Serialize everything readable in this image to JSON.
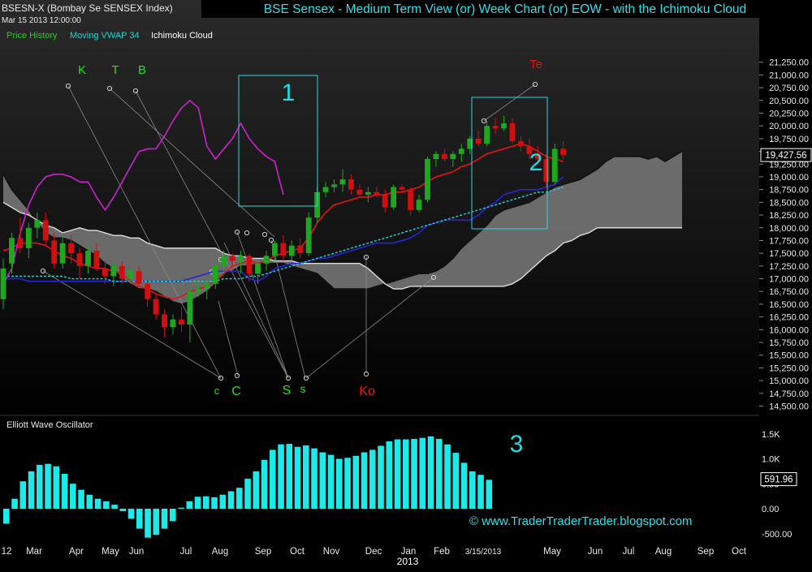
{
  "header": {
    "symbol": "BSESN-X (Bombay Se SENSEX Index)",
    "datetime": "Mar 15 2013 12:00:00",
    "title": "BSE Sensex - Medium Term View (or) Week Chart (or) EOW - with the Ichimoku Cloud"
  },
  "legend": {
    "items": [
      {
        "label": "Price History",
        "color": "#22cc22"
      },
      {
        "label": "Moving VWAP 34",
        "color": "#22d3d3"
      },
      {
        "label": "Ichimoku Cloud",
        "color": "#ffffff"
      }
    ]
  },
  "colors": {
    "background": "#000000",
    "up_candle": "#1fa81f",
    "down_candle": "#d01010",
    "tenkan": "#e01515",
    "kijun": "#2626d8",
    "vwap": "#22d3d3",
    "chikou": "#cc22cc",
    "cloud_fill": "#7a7a7a",
    "span_a": "#111111",
    "span_b": "#dddddd",
    "oscillator": "#1ee8e8",
    "annotation_box": "#2ad8e0",
    "accent_red": "#e01515"
  },
  "price_panel": {
    "ylim": [
      14500,
      21500
    ],
    "y_ticks": [
      "21,250.00",
      "21,000.00",
      "20,750.00",
      "20,500.00",
      "20,250.00",
      "20,000.00",
      "19,750.00",
      "19,500.00",
      "19,250.00",
      "19,000.00",
      "18,750.00",
      "18,500.00",
      "18,250.00",
      "18,000.00",
      "17,750.00",
      "17,500.00",
      "17,250.00",
      "17,000.00",
      "16,750.00",
      "16,500.00",
      "16,250.00",
      "16,000.00",
      "15,750.00",
      "15,500.00",
      "15,250.00",
      "15,000.00",
      "14,750.00",
      "14,500.00"
    ],
    "last_value": "19,427.56",
    "box_labels": [
      "1",
      "2"
    ]
  },
  "oscillator_panel": {
    "title": "Elliott Wave Oscillator",
    "ylim": [
      -600,
      1600
    ],
    "y_ticks": [
      "1.5K",
      "1.0K",
      "0.50",
      "0.00",
      "-500.00"
    ],
    "last_value": "591.96",
    "box_label": "3"
  },
  "x_axis": {
    "labels": [
      "12",
      "Mar",
      "Apr",
      "May",
      "Jun",
      "Jul",
      "Aug",
      "Sep",
      "Oct",
      "Nov",
      "Dec",
      "Jan",
      "Feb",
      "3/15/2013",
      "May",
      "Jun",
      "Jul",
      "Aug",
      "Sep",
      "Oct"
    ],
    "year_label": "2013"
  },
  "annotations": {
    "top_green": [
      "K",
      "T",
      "B"
    ],
    "top_red": "Te",
    "bottom_green": [
      "c",
      "C",
      "S",
      "s"
    ],
    "bottom_red": "Ko"
  },
  "watermark": "© www.TraderTraderTrader.blogspot.com",
  "chart_data": {
    "type": "candlestick",
    "title": "BSE Sensex - Medium Term View (or) Week Chart (or) EOW - with the Ichimoku Cloud",
    "candles": [
      {
        "o": 16600,
        "h": 17400,
        "l": 16400,
        "c": 17200
      },
      {
        "o": 17300,
        "h": 17900,
        "l": 17100,
        "c": 17800
      },
      {
        "o": 17800,
        "h": 18200,
        "l": 17500,
        "c": 17600
      },
      {
        "o": 17600,
        "h": 18100,
        "l": 17400,
        "c": 18000
      },
      {
        "o": 18000,
        "h": 18300,
        "l": 17800,
        "c": 18150
      },
      {
        "o": 18150,
        "h": 18300,
        "l": 17650,
        "c": 17750
      },
      {
        "o": 17750,
        "h": 17900,
        "l": 17200,
        "c": 17300
      },
      {
        "o": 17300,
        "h": 17900,
        "l": 17200,
        "c": 17700
      },
      {
        "o": 17700,
        "h": 17850,
        "l": 17300,
        "c": 17500
      },
      {
        "o": 17500,
        "h": 17600,
        "l": 17000,
        "c": 17250
      },
      {
        "o": 17250,
        "h": 17650,
        "l": 17100,
        "c": 17550
      },
      {
        "o": 17550,
        "h": 17700,
        "l": 17150,
        "c": 17200
      },
      {
        "o": 17200,
        "h": 17350,
        "l": 16900,
        "c": 17050
      },
      {
        "o": 17050,
        "h": 17350,
        "l": 16850,
        "c": 17250
      },
      {
        "o": 17250,
        "h": 17350,
        "l": 16900,
        "c": 17000
      },
      {
        "o": 17000,
        "h": 17200,
        "l": 16900,
        "c": 17150
      },
      {
        "o": 17150,
        "h": 17250,
        "l": 16850,
        "c": 16900
      },
      {
        "o": 16900,
        "h": 16950,
        "l": 16450,
        "c": 16600
      },
      {
        "o": 16600,
        "h": 16700,
        "l": 16200,
        "c": 16300
      },
      {
        "o": 16300,
        "h": 16400,
        "l": 15850,
        "c": 16050
      },
      {
        "o": 16050,
        "h": 16300,
        "l": 15900,
        "c": 16200
      },
      {
        "o": 16200,
        "h": 16450,
        "l": 15950,
        "c": 16100
      },
      {
        "o": 16100,
        "h": 16850,
        "l": 15750,
        "c": 16750
      },
      {
        "o": 16750,
        "h": 16950,
        "l": 16650,
        "c": 16800
      },
      {
        "o": 16800,
        "h": 17000,
        "l": 16600,
        "c": 16900
      },
      {
        "o": 16900,
        "h": 17300,
        "l": 16800,
        "c": 17250
      },
      {
        "o": 17250,
        "h": 17550,
        "l": 17100,
        "c": 17450
      },
      {
        "o": 17450,
        "h": 17500,
        "l": 17250,
        "c": 17350
      },
      {
        "o": 17350,
        "h": 17550,
        "l": 17100,
        "c": 17450
      },
      {
        "o": 17450,
        "h": 17500,
        "l": 16950,
        "c": 17100
      },
      {
        "o": 17100,
        "h": 17350,
        "l": 16900,
        "c": 17300
      },
      {
        "o": 17300,
        "h": 17550,
        "l": 17150,
        "c": 17450
      },
      {
        "o": 17450,
        "h": 17750,
        "l": 17350,
        "c": 17700
      },
      {
        "o": 17700,
        "h": 17850,
        "l": 17350,
        "c": 17450
      },
      {
        "o": 17450,
        "h": 17750,
        "l": 17350,
        "c": 17650
      },
      {
        "o": 17650,
        "h": 17800,
        "l": 17400,
        "c": 17500
      },
      {
        "o": 17500,
        "h": 18300,
        "l": 17450,
        "c": 18200
      },
      {
        "o": 18200,
        "h": 18800,
        "l": 18100,
        "c": 18700
      },
      {
        "o": 18700,
        "h": 18900,
        "l": 18600,
        "c": 18800
      },
      {
        "o": 18800,
        "h": 18950,
        "l": 18700,
        "c": 18850
      },
      {
        "o": 18850,
        "h": 19150,
        "l": 18700,
        "c": 18950
      },
      {
        "o": 18950,
        "h": 19050,
        "l": 18650,
        "c": 18750
      },
      {
        "o": 18750,
        "h": 18850,
        "l": 18600,
        "c": 18650
      },
      {
        "o": 18650,
        "h": 18800,
        "l": 18500,
        "c": 18700
      },
      {
        "o": 18700,
        "h": 18800,
        "l": 18600,
        "c": 18650
      },
      {
        "o": 18650,
        "h": 18750,
        "l": 18300,
        "c": 18400
      },
      {
        "o": 18400,
        "h": 18850,
        "l": 18350,
        "c": 18800
      },
      {
        "o": 18800,
        "h": 18850,
        "l": 18700,
        "c": 18750
      },
      {
        "o": 18750,
        "h": 18800,
        "l": 18250,
        "c": 18350
      },
      {
        "o": 18350,
        "h": 18650,
        "l": 18300,
        "c": 18550
      },
      {
        "o": 18550,
        "h": 19400,
        "l": 18500,
        "c": 19350
      },
      {
        "o": 19350,
        "h": 19500,
        "l": 19200,
        "c": 19450
      },
      {
        "o": 19450,
        "h": 19550,
        "l": 19300,
        "c": 19350
      },
      {
        "o": 19350,
        "h": 19500,
        "l": 19200,
        "c": 19450
      },
      {
        "o": 19450,
        "h": 19650,
        "l": 19300,
        "c": 19550
      },
      {
        "o": 19550,
        "h": 19800,
        "l": 19450,
        "c": 19750
      },
      {
        "o": 19750,
        "h": 19900,
        "l": 19600,
        "c": 19650
      },
      {
        "o": 19650,
        "h": 20100,
        "l": 19600,
        "c": 20000
      },
      {
        "o": 20000,
        "h": 20150,
        "l": 19850,
        "c": 19950
      },
      {
        "o": 19950,
        "h": 20200,
        "l": 19900,
        "c": 20050
      },
      {
        "o": 20050,
        "h": 20150,
        "l": 19650,
        "c": 19700
      },
      {
        "o": 19700,
        "h": 19800,
        "l": 19500,
        "c": 19600
      },
      {
        "o": 19600,
        "h": 19750,
        "l": 19350,
        "c": 19450
      },
      {
        "o": 19450,
        "h": 19600,
        "l": 19250,
        "c": 19350
      },
      {
        "o": 19350,
        "h": 19450,
        "l": 18800,
        "c": 18900
      },
      {
        "o": 18900,
        "h": 19650,
        "l": 18850,
        "c": 19550
      },
      {
        "o": 19550,
        "h": 19700,
        "l": 19350,
        "c": 19427.56
      }
    ],
    "tenkan": [
      17550,
      17600,
      17700,
      17700,
      17700,
      17650,
      17550,
      17450,
      17400,
      17300,
      17250,
      17200,
      17200,
      17150,
      17100,
      16950,
      16850,
      16800,
      16700,
      16650,
      16600,
      16650,
      16750,
      16800,
      16850,
      16950,
      17100,
      17250,
      17300,
      17350,
      17300,
      17350,
      17450,
      17500,
      17550,
      17600,
      17800,
      18100,
      18300,
      18450,
      18500,
      18550,
      18600,
      18600,
      18650,
      18650,
      18700,
      18700,
      18750,
      18800,
      18900,
      19000,
      19050,
      19100,
      19200,
      19250,
      19350,
      19450,
      19500,
      19550,
      19600,
      19650,
      19600,
      19500,
      19400,
      19350,
      19300
    ],
    "kijun": [
      17000,
      17000,
      17000,
      16950,
      16950,
      16950,
      16950,
      16950,
      16950,
      16950,
      16950,
      16950,
      16950,
      16950,
      16950,
      16950,
      16950,
      16950,
      16950,
      16950,
      16950,
      16950,
      17000,
      17050,
      17100,
      17150,
      17150,
      17150,
      17150,
      17000,
      16950,
      17050,
      17200,
      17250,
      17300,
      17300,
      17350,
      17400,
      17400,
      17450,
      17500,
      17550,
      17600,
      17650,
      17700,
      17700,
      17700,
      17750,
      17800,
      17900,
      18050,
      18100,
      18150,
      18150,
      18150,
      18150,
      18250,
      18400,
      18500,
      18650,
      18700,
      18750,
      18750,
      18750,
      18800,
      18850,
      19000
    ],
    "vwap": [
      17050,
      17050,
      17050,
      17050,
      17050,
      17050,
      17050,
      17050,
      17000,
      17000,
      17000,
      17000,
      17000,
      16950,
      16950,
      16950,
      16950,
      16950,
      16950,
      16950,
      16950,
      16950,
      16950,
      16950,
      16950,
      16950,
      17000,
      17000,
      17000,
      17050,
      17050,
      17100,
      17150,
      17200,
      17250,
      17300,
      17350,
      17400,
      17450,
      17500,
      17550,
      17600,
      17650,
      17700,
      17750,
      17800,
      17850,
      17900,
      17950,
      18000,
      18050,
      18100,
      18150,
      18200,
      18250,
      18300,
      18350,
      18400,
      18450,
      18500,
      18550,
      18600,
      18650,
      18700,
      18700,
      18750,
      18800
    ],
    "chikou": [
      16900,
      17200,
      17900,
      18450,
      18800,
      19000,
      19050,
      19050,
      19000,
      18900,
      18900,
      18600,
      18350,
      18600,
      18900,
      19200,
      19500,
      19550,
      19550,
      19800,
      20100,
      20350,
      20500,
      20350,
      19600,
      19350,
      19550,
      19750,
      20050,
      19750,
      19550,
      19400,
      19300,
      18650
    ],
    "span_a": [
      19050,
      18750,
      18550,
      18350,
      18100,
      17900,
      17800,
      17800,
      17750,
      17650,
      17550,
      17450,
      17300,
      17200,
      17000,
      16900,
      16800,
      16800,
      16750,
      16650,
      16550,
      16500,
      16550,
      16650,
      16750,
      16900,
      17100,
      17150,
      17250,
      17250,
      17300,
      17300,
      17300,
      17300,
      17250,
      17200,
      17150,
      17100,
      16950,
      16800,
      16800,
      16800,
      16800,
      16800,
      16850,
      16900,
      16950,
      17000,
      17050,
      17100,
      17100,
      17150,
      17250,
      17400,
      17600,
      17750,
      17900,
      18050,
      18250,
      18350,
      18400,
      18450,
      18500,
      18600,
      18700,
      18800,
      18850,
      18900,
      18950,
      19050,
      19150,
      19300,
      19400,
      19400,
      19400,
      19400,
      19350,
      19400,
      19300,
      19400,
      19500
    ],
    "span_b": [
      18500,
      18400,
      18300,
      18250,
      18150,
      18050,
      18000,
      17900,
      17950,
      18000,
      17950,
      17950,
      17900,
      17850,
      17850,
      17800,
      17800,
      17700,
      17650,
      17600,
      17600,
      17600,
      17600,
      17600,
      17600,
      17600,
      17500,
      17450,
      17450,
      17400,
      17400,
      17400,
      17350,
      17350,
      17350,
      17300,
      17300,
      17300,
      17300,
      17300,
      17300,
      17300,
      17300,
      17200,
      17050,
      16900,
      16800,
      16800,
      16850,
      16850,
      16850,
      16850,
      16850,
      16850,
      16850,
      16850,
      16850,
      16850,
      16850,
      16850,
      16900,
      17000,
      17150,
      17300,
      17450,
      17550,
      17700,
      17750,
      17850,
      17900,
      18000,
      18000,
      18000,
      18000,
      18000,
      18000,
      18000,
      18000,
      18000,
      18000,
      18000
    ],
    "oscillator": {
      "title": "Elliott Wave Oscillator",
      "values": [
        -300,
        200,
        550,
        750,
        880,
        900,
        850,
        700,
        500,
        380,
        280,
        200,
        150,
        80,
        -50,
        -200,
        -400,
        -580,
        -520,
        -400,
        -250,
        20,
        150,
        240,
        250,
        230,
        280,
        350,
        420,
        600,
        750,
        980,
        1180,
        1290,
        1300,
        1240,
        1270,
        1210,
        1130,
        1080,
        1000,
        1020,
        1060,
        1130,
        1180,
        1260,
        1350,
        1390,
        1390,
        1400,
        1420,
        1450,
        1400,
        1290,
        1120,
        920,
        750,
        680,
        580
      ]
    },
    "last_price": 19427.56,
    "last_osc": 591.96
  }
}
